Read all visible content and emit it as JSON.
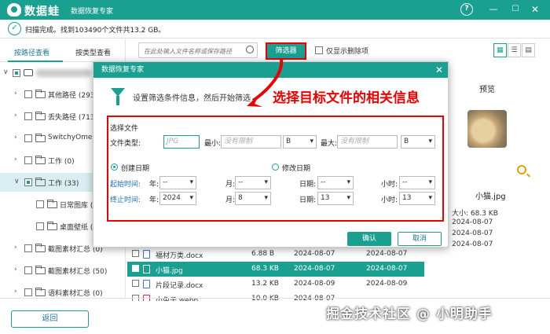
{
  "app": {
    "name": "数据蛙",
    "subtitle": "数据恢复专家"
  },
  "status": {
    "text": "扫描完成。找到103490个文件共13.2 GB。"
  },
  "left_panel": {
    "tabs": [
      "按路径查看",
      "按类型查看"
    ],
    "tree": [
      {
        "label": "其他路径 (2935"
      },
      {
        "label": "丢失路径 (7139"
      },
      {
        "label": "SwitchyOmega"
      },
      {
        "label": "工作 (0)"
      },
      {
        "label": "工作 (33)"
      },
      {
        "label": "日常图库 (2"
      },
      {
        "label": "桌面壁纸 (1"
      },
      {
        "label": "截图素材汇总 (0)"
      },
      {
        "label": "截图素材汇总 (50)"
      },
      {
        "label": "语料素材汇总 (0)"
      }
    ],
    "back_label": "返回"
  },
  "toolbar": {
    "search_placeholder": "在此处输入文件名称或保存路径",
    "filter_label": "筛选器",
    "deleted_only_label": "仅显示删除项"
  },
  "files": [
    {
      "name": "福材万类.docx",
      "size": "6.88 B",
      "date": "2024-08-07"
    },
    {
      "name": "小猫.jpg",
      "size": "68.3 KB",
      "date": "2024-08-07"
    },
    {
      "name": "片段记录.docx",
      "size": "13.2 KB",
      "date": "2024-08-09"
    },
    {
      "name": "小兔子.webp",
      "size": "10.0 KB",
      "date": "2024-08-07"
    }
  ],
  "preview": {
    "title": "预览",
    "name": "小猫.jpg",
    "lines": [
      "大小: 68.3 KB",
      "2024-08-07",
      "2024-08-07",
      "2024-08-07"
    ]
  },
  "dialog": {
    "title": "数据恢复专家",
    "description": "设置筛选条件信息，然后开始筛选",
    "annotation": "选择目标文件的相关信息",
    "section": "选择文件",
    "type_label": "文件类型:",
    "type_placeholder": "JPG",
    "min_label": "最小:",
    "min_placeholder": "没有限制",
    "min_unit": "B",
    "max_label": "最大:",
    "max_placeholder": "没有限制",
    "max_unit": "B",
    "create_date_label": "创建日期",
    "modify_date_label": "修改日期",
    "start_label": "起始时间:",
    "end_label": "终止时间:",
    "year_label": "年:",
    "month_label": "月:",
    "day_label": "日期:",
    "hour_label": "小时:",
    "start": {
      "year": "--",
      "month": "--",
      "day": "--",
      "hour": "--"
    },
    "end": {
      "year": "2024",
      "month": "8",
      "day": "13",
      "hour": "13"
    },
    "ok_label": "确认",
    "cancel_label": "取消"
  },
  "watermark": "掘金技术社区 @ 小明助手",
  "colors": {
    "accent": "#1aa091",
    "annotation": "#e00000"
  }
}
